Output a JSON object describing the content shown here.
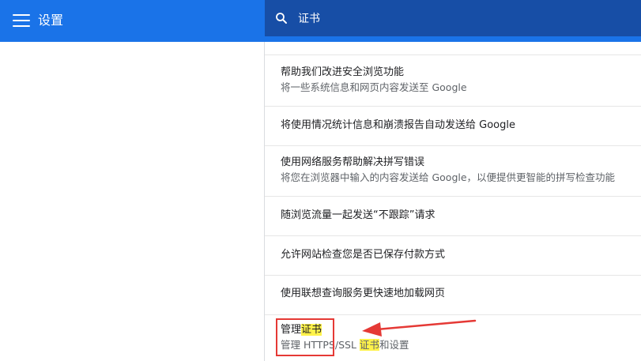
{
  "header": {
    "title": "设置",
    "search_value": "证书"
  },
  "settings": [
    {
      "primary": "帮助我们改进安全浏览功能",
      "secondary": "将一些系统信息和网页内容发送至 Google"
    },
    {
      "primary": "将使用情况统计信息和崩溃报告自动发送给 Google"
    },
    {
      "primary": "使用网络服务帮助解决拼写错误",
      "secondary": "将您在浏览器中输入的内容发送给 Google，以便提供更智能的拼写检查功能"
    },
    {
      "primary": "随浏览流量一起发送“不跟踪”请求"
    },
    {
      "primary": "允许网站检查您是否已保存付款方式"
    },
    {
      "primary": "使用联想查询服务更快速地加载网页"
    },
    {
      "primary_pre": "管理",
      "primary_hl": "证书",
      "secondary_pre": "管理 HTTPS/SSL ",
      "secondary_hl": "证书",
      "secondary_post": "和设置"
    }
  ],
  "colors": {
    "header_bg": "#1a73e8",
    "search_bg": "#174ea6",
    "highlight": "#fff24a",
    "annotation": "#e53935"
  }
}
